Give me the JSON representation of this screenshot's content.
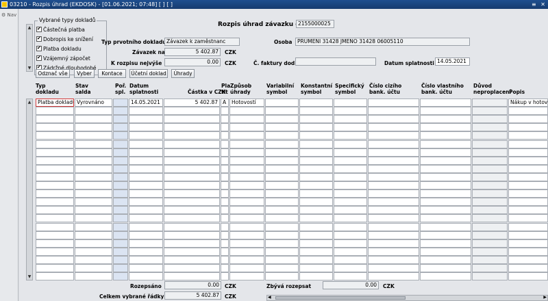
{
  "window": {
    "title": "03210 - Rozpis úhrad (EKDOSK) - [01.06.2021; 07:48] [ ] [ ]",
    "controls": "≡ ✕"
  },
  "nav": {
    "label": "Nav"
  },
  "header": {
    "title": "Rozpis úhrad závazku č.",
    "doc_number": "2155000025"
  },
  "types_group": {
    "title": "Vybrané typy dokladů",
    "items": [
      "Částečná platba",
      "Dobropis ke snížení",
      "Platba dokladu",
      "Vzájemný zápočet",
      "Zádržné dlouhodobé"
    ]
  },
  "form": {
    "typ_label": "Typ prvotního dokladu",
    "typ_value": "Závazek k zaměstnanc",
    "osoba_label": "Osoba",
    "osoba_value": "PRUMENI 31428 JMENO 31428 06005110",
    "zavazek_label": "Závazek na",
    "zavazek_value": "5 402.87",
    "zavazek_ccy": "CZK",
    "krozpisu_label": "K rozpisu nejvýše",
    "krozpisu_value": "0.00",
    "krozpisu_ccy": "CZK",
    "cfaktury_label": "Č. faktury dod.",
    "cfaktury_value": "",
    "splatnost_label": "Datum splatnosti",
    "splatnost_value": "14.05.2021"
  },
  "toolbar": {
    "odznac": "Odznač vše",
    "vyber": "Vyber",
    "kontace": "Kontace",
    "ucetni": "Účetní doklad",
    "uhrady": "Úhrady"
  },
  "columns": {
    "typ": [
      "Typ",
      "dokladu"
    ],
    "stav": [
      "Stav",
      "salda"
    ],
    "por": [
      "Poř.",
      "spl."
    ],
    "datum": [
      "Datum",
      "splatnosti"
    ],
    "castka": "Částka v",
    "castka_ccy": "CZK",
    "plat": [
      "Pla",
      "tit"
    ],
    "zpusob": [
      "Způsob",
      "úhrady"
    ],
    "vs": [
      "Variabilní",
      "symbol"
    ],
    "ks": [
      "Konstantní",
      "symbol"
    ],
    "ss": [
      "Specifický",
      "symbol"
    ],
    "cizi": [
      "Číslo cizího",
      "bank. účtu"
    ],
    "vlastni": [
      "Číslo vlastního",
      "bank. účtu"
    ],
    "duvod": [
      "Důvod",
      "neproplacení"
    ],
    "popis": "Popis"
  },
  "rows": [
    {
      "typ": "Platba dokladu",
      "stav": "Vyrovnáno",
      "por": "",
      "datum": "14.05.2021",
      "castka": "5 402.87",
      "plat": "A",
      "zpusob": "Hotovostí",
      "vs": "",
      "ks": "",
      "ss": "",
      "cizi": "",
      "vlastni": "",
      "duvod": "",
      "popis": "Nákup v hotovo"
    }
  ],
  "footer": {
    "rozepsano_label": "Rozepsáno",
    "rozepsano_value": "0.00",
    "rozepsano_ccy": "CZK",
    "zbyva_label": "Zbývá rozepsat",
    "zbyva_value": "0.00",
    "zbyva_ccy": "CZK",
    "celkem_label": "Celkem vybrané řádky",
    "celkem_value": "5 402.87",
    "celkem_ccy": "CZK"
  }
}
